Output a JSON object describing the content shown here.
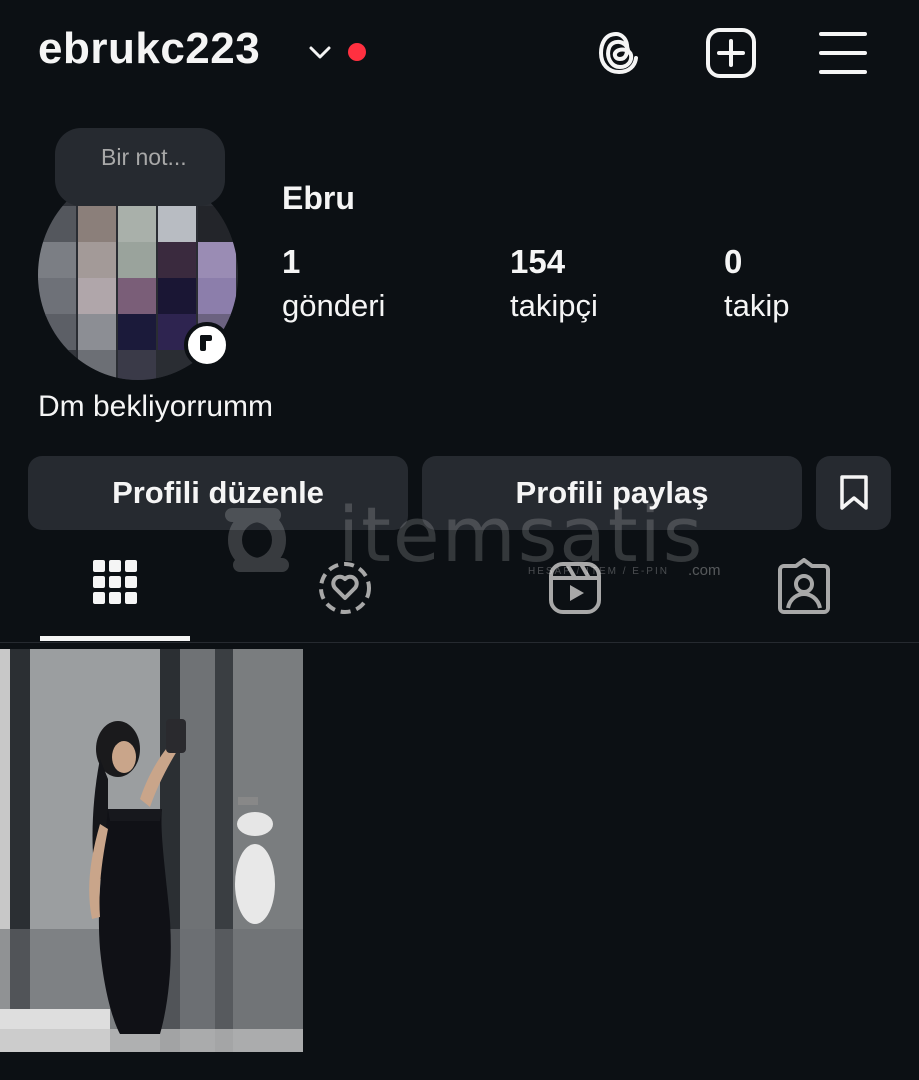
{
  "header": {
    "username": "ebrukc223",
    "icons": [
      "chevron-down-icon",
      "notification-dot",
      "threads-icon",
      "create-post-icon",
      "menu-icon"
    ]
  },
  "profile": {
    "note_placeholder": "Bir not...",
    "full_name": "Ebru",
    "bio": "Dm bekliyorrumm",
    "stats": [
      {
        "value": "1",
        "label": "gönderi"
      },
      {
        "value": "154",
        "label": "takipçi"
      },
      {
        "value": "0",
        "label": "takip"
      }
    ]
  },
  "actions": {
    "edit_profile": "Profili düzenle",
    "share_profile": "Profili paylaş",
    "saved_icon": "bookmark-icon"
  },
  "watermark": {
    "text": "itemsatis",
    "sub": "HESAP / ITEM / E-PIN",
    "suffix": ".com"
  },
  "tabs": [
    {
      "icon": "grid-icon",
      "active": true
    },
    {
      "icon": "highlights-icon",
      "active": false
    },
    {
      "icon": "reels-icon",
      "active": false
    },
    {
      "icon": "tagged-icon",
      "active": false
    }
  ],
  "posts_count_visible": 1,
  "colors": {
    "background": "#0c1014",
    "surface": "#262a30",
    "text": "#f5f5f5",
    "notification": "#ff3040"
  }
}
